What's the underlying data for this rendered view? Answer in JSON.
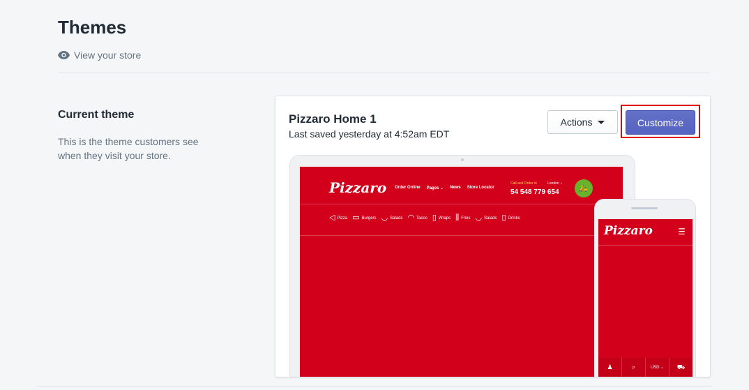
{
  "page": {
    "title": "Themes",
    "view_store": "View your store"
  },
  "section": {
    "title": "Current theme",
    "description": "This is the theme customers see when they visit your store."
  },
  "theme": {
    "name": "Pizzaro Home 1",
    "saved": "Last saved yesterday at 4:52am EDT",
    "actions_label": "Actions",
    "customize_label": "Customize"
  },
  "preview": {
    "logo": "Pizzaro",
    "nav": [
      "Order Online",
      "Pages ⌄",
      "News",
      "Store Locator"
    ],
    "call_label": "Call and Order in",
    "location": "London ⌄",
    "phone": "54 548 779 654",
    "categories": [
      "Pizza",
      "Burgers",
      "Salads",
      "Tacos",
      "Wraps",
      "Fries",
      "Salads",
      "Drinks"
    ],
    "currency": "USD"
  },
  "colors": {
    "brand_red": "#d2001b",
    "primary": "#5c6ac4",
    "highlight": "#e00000"
  },
  "icons": [
    "eye-icon",
    "caret-down-icon",
    "scooter-icon",
    "menu-icon",
    "user-icon",
    "search-icon",
    "cart-icon"
  ]
}
